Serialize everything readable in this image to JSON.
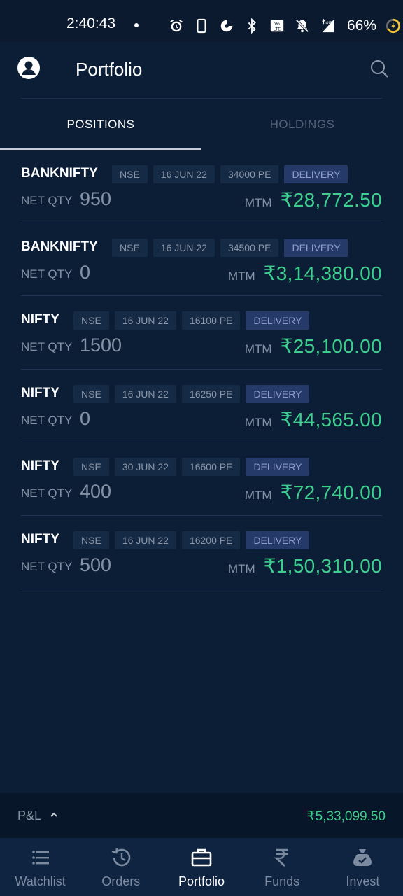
{
  "status_bar": {
    "time": "2:40:43",
    "battery": "66%"
  },
  "header": {
    "title": "Portfolio"
  },
  "tabs": [
    {
      "label": "POSITIONS",
      "active": true
    },
    {
      "label": "HOLDINGS",
      "active": false
    }
  ],
  "positions": [
    {
      "symbol": "BANKNIFTY",
      "exchange": "NSE",
      "expiry": "16 JUN 22",
      "strike": "34000 PE",
      "product": "DELIVERY",
      "net_qty_label": "NET QTY",
      "net_qty": "950",
      "mtm_label": "MTM",
      "mtm": "₹28,772.50"
    },
    {
      "symbol": "BANKNIFTY",
      "exchange": "NSE",
      "expiry": "16 JUN 22",
      "strike": "34500 PE",
      "product": "DELIVERY",
      "net_qty_label": "NET QTY",
      "net_qty": "0",
      "mtm_label": "MTM",
      "mtm": "₹3,14,380.00"
    },
    {
      "symbol": "NIFTY",
      "exchange": "NSE",
      "expiry": "16 JUN 22",
      "strike": "16100 PE",
      "product": "DELIVERY",
      "net_qty_label": "NET QTY",
      "net_qty": "1500",
      "mtm_label": "MTM",
      "mtm": "₹25,100.00"
    },
    {
      "symbol": "NIFTY",
      "exchange": "NSE",
      "expiry": "16 JUN 22",
      "strike": "16250 PE",
      "product": "DELIVERY",
      "net_qty_label": "NET QTY",
      "net_qty": "0",
      "mtm_label": "MTM",
      "mtm": "₹44,565.00"
    },
    {
      "symbol": "NIFTY",
      "exchange": "NSE",
      "expiry": "30 JUN 22",
      "strike": "16600 PE",
      "product": "DELIVERY",
      "net_qty_label": "NET QTY",
      "net_qty": "400",
      "mtm_label": "MTM",
      "mtm": "₹72,740.00"
    },
    {
      "symbol": "NIFTY",
      "exchange": "NSE",
      "expiry": "16 JUN 22",
      "strike": "16200 PE",
      "product": "DELIVERY",
      "net_qty_label": "NET QTY",
      "net_qty": "500",
      "mtm_label": "MTM",
      "mtm": "₹1,50,310.00"
    }
  ],
  "pnl": {
    "label": "P&L",
    "value": "₹5,33,099.50"
  },
  "bottom_nav": [
    {
      "label": "Watchlist",
      "icon": "list-icon",
      "active": false
    },
    {
      "label": "Orders",
      "icon": "history-icon",
      "active": false
    },
    {
      "label": "Portfolio",
      "icon": "briefcase-icon",
      "active": true
    },
    {
      "label": "Funds",
      "icon": "rupee-icon",
      "active": false
    },
    {
      "label": "Invest",
      "icon": "money-bag-icon",
      "active": false
    }
  ],
  "colors": {
    "background": "#0c1e36",
    "profit_green": "#3ecf8e",
    "delivery_tag": "#263a6a"
  }
}
